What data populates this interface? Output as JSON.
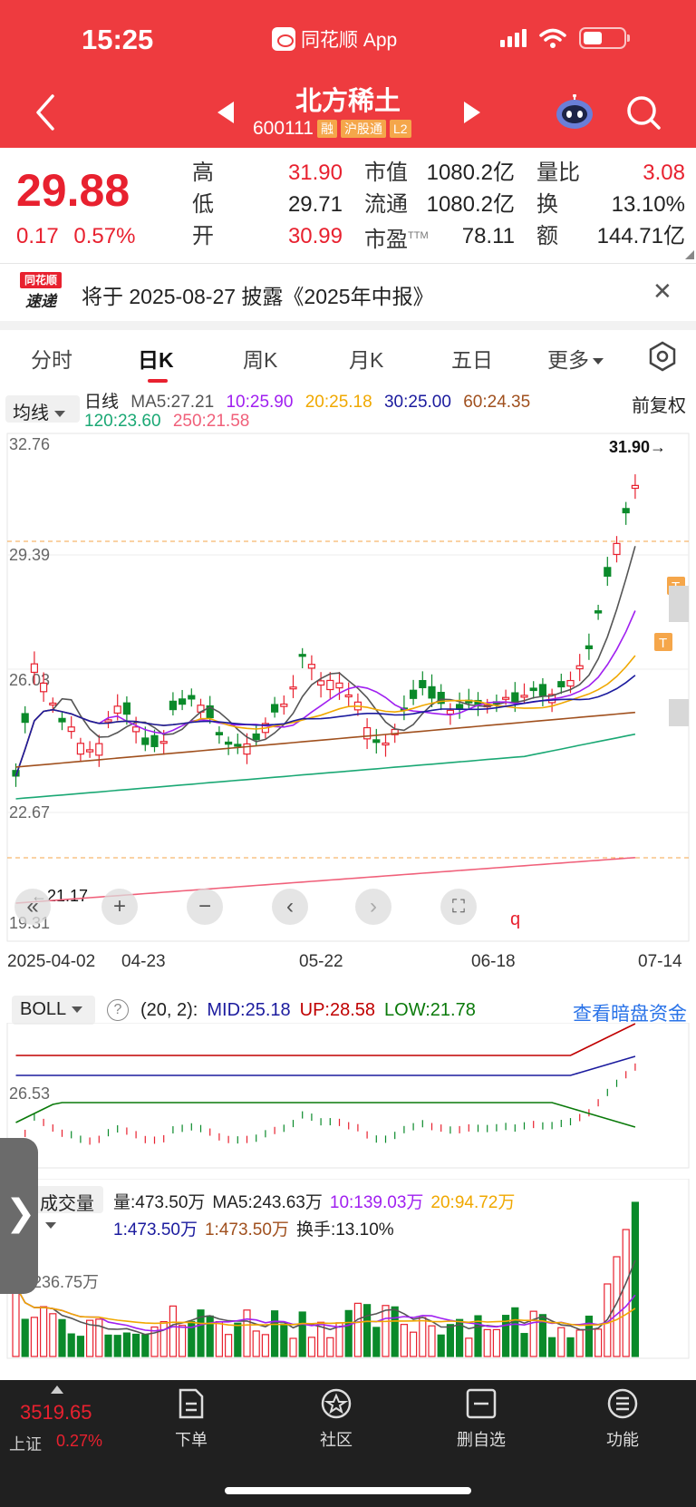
{
  "status_bar": {
    "time": "15:25",
    "app_name": "同花顺 App"
  },
  "header": {
    "title": "北方稀土",
    "code": "600111",
    "tags": [
      "融",
      "沪股通",
      "L2"
    ]
  },
  "quote": {
    "price": "29.88",
    "change": "0.17",
    "change_pct": "0.57%",
    "col1": [
      {
        "label": "高",
        "value": "31.90"
      },
      {
        "label": "低",
        "value": "29.71"
      },
      {
        "label": "开",
        "value": "30.99"
      }
    ],
    "col2": [
      {
        "label": "市值",
        "value": "1080.2亿"
      },
      {
        "label": "流通",
        "value": "1080.2亿"
      },
      {
        "label": "市盈",
        "sup": "TTM",
        "value": "78.11"
      }
    ],
    "col3": [
      {
        "label": "量比",
        "value": "3.08"
      },
      {
        "label": "换",
        "value": "13.10%"
      },
      {
        "label": "额",
        "value": "144.71亿"
      }
    ]
  },
  "notice": {
    "logo_top": "同花顺",
    "logo_bottom": "速递",
    "text": "将于 2025-08-27 披露《2025年中报》"
  },
  "tabs": [
    "分时",
    "日K",
    "周K",
    "月K",
    "五日",
    "更多"
  ],
  "active_tab": "日K",
  "ma_legend": {
    "selector": "均线",
    "period": "日线",
    "items1": [
      "MA5:27.21",
      "10:25.90",
      "20:25.18",
      "30:25.00",
      "60:24.35"
    ],
    "items2": [
      "120:23.60",
      "250:21.58"
    ],
    "adjust": "前复权"
  },
  "colors": {
    "up": "#e8212f",
    "down": "#0a8a2a",
    "ma5": "#555555",
    "ma10": "#a020f0",
    "ma20": "#f0a800",
    "ma30": "#1b1b9e",
    "ma60": "#a0501e",
    "ma120": "#1aa874",
    "ma250": "#f0607a"
  },
  "kline": {
    "y_labels": [
      "32.76",
      "29.39",
      "26.03",
      "22.67",
      "19.31"
    ],
    "high_marker": "31.90→",
    "low_marker": "←21.17",
    "tick_mark": "q",
    "t_badge": "T",
    "dates": [
      "2025-04-02",
      "04-23",
      "05-22",
      "06-18",
      "07-14"
    ]
  },
  "chart_data": {
    "type": "candlestick",
    "title": "北方稀土 日K",
    "ylim": [
      19.31,
      32.76
    ],
    "x_ticks": [
      "2025-04-02",
      "04-23",
      "05-22",
      "06-18",
      "07-14"
    ],
    "last_close": 29.88,
    "high": 31.9,
    "low_marker": 21.17,
    "ma": {
      "MA5": 27.21,
      "MA10": 25.9,
      "MA20": 25.18,
      "MA30": 25.0,
      "MA60": 24.35,
      "MA120": 23.6,
      "MA250": 21.58
    },
    "boll": {
      "MID": 25.18,
      "UP": 28.58,
      "LOW": 21.78,
      "y_label": 26.53
    },
    "volume": {
      "vol": "473.50万",
      "MA5": "243.63万",
      "MA10": "139.03万",
      "MA20": "94.72万",
      "turnover": "13.10%",
      "y_label": "236.75万"
    }
  },
  "boll_legend": {
    "selector": "BOLL",
    "params": "(20, 2):",
    "mid": "MID:25.18",
    "up": "UP:28.58",
    "low": "LOW:21.78",
    "y_label": "26.53",
    "link": "查看暗盘资金"
  },
  "volume_legend": {
    "selector": "成交量",
    "items1": [
      "量:473.50万",
      "MA5:243.63万",
      "10:139.03万",
      "20:94.72万"
    ],
    "items2": [
      "1:473.50万",
      "1:473.50万",
      "换手:13.10%"
    ],
    "y_label": "236.75万"
  },
  "bottom_bar": {
    "index_value": "3519.65",
    "index_name": "上证",
    "index_pct": "0.27%",
    "items": [
      "下单",
      "社区",
      "删自选",
      "功能"
    ]
  }
}
